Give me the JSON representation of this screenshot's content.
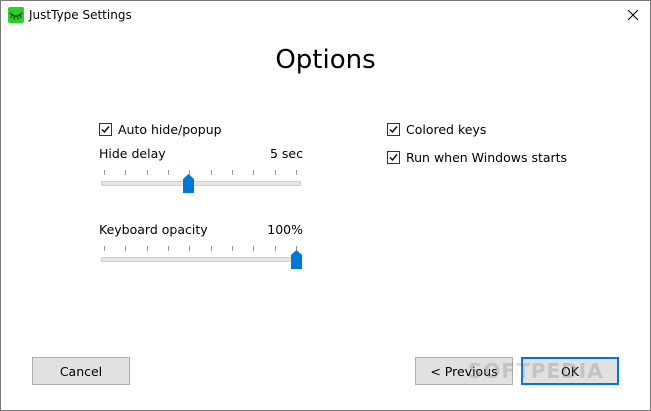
{
  "window": {
    "title": "JustType Settings"
  },
  "icons": {
    "app": "eye-lashes-icon",
    "close": "close-icon"
  },
  "heading": "Options",
  "options": {
    "auto_hide": {
      "label": "Auto hide/popup",
      "checked": true
    },
    "hide_delay": {
      "label": "Hide delay",
      "value": "5 sec",
      "level": 0.44
    },
    "keyboard_opacity": {
      "label": "Keyboard opacity",
      "value": "100%",
      "level": 1.0
    },
    "colored_keys": {
      "label": "Colored keys",
      "checked": true
    },
    "run_on_start": {
      "label": "Run when Windows starts",
      "checked": true
    }
  },
  "buttons": {
    "cancel": "Cancel",
    "previous": "< Previous",
    "ok": "OK"
  },
  "watermark": "SOFTPEDIA",
  "colors": {
    "accent": "#0078d7",
    "app_icon": "#22c55e"
  }
}
